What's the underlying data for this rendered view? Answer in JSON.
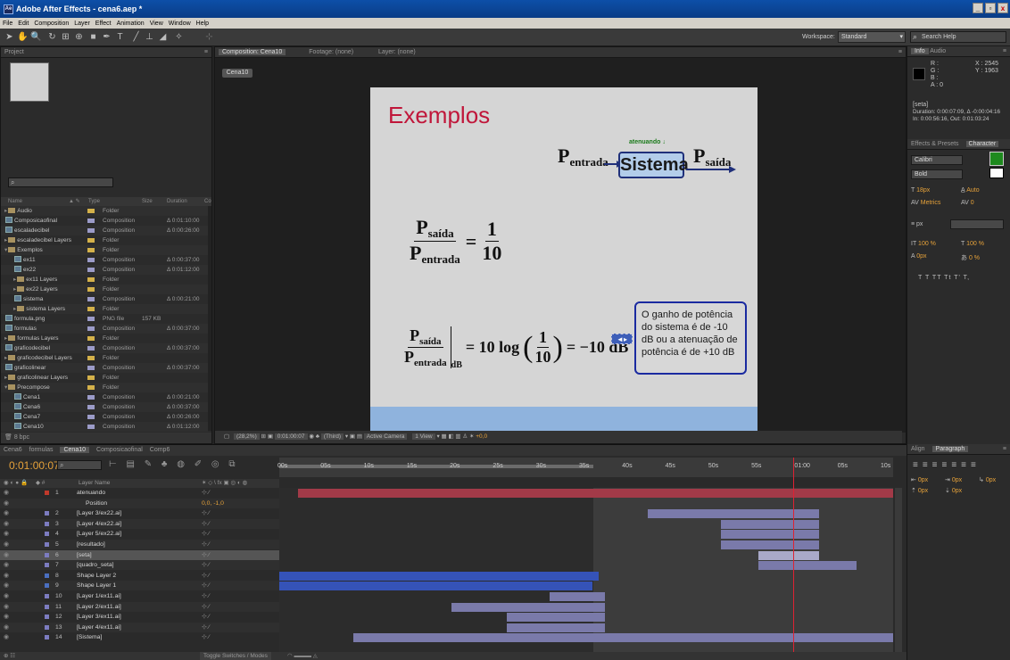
{
  "window": {
    "title": "Adobe After Effects - cena6.aep *",
    "min": "_",
    "restore": "▫",
    "close": "x"
  },
  "menu": [
    "File",
    "Edit",
    "Composition",
    "Layer",
    "Effect",
    "Animation",
    "View",
    "Window",
    "Help"
  ],
  "toolbar": {
    "workspace_label": "Workspace:",
    "workspace_value": "Standard",
    "search_placeholder": "Search Help"
  },
  "project": {
    "tab": "Project",
    "columns": {
      "name": "Name",
      "type": "Type",
      "size": "Size",
      "duration": "Duration",
      "extra": "Co"
    },
    "items": [
      {
        "name": "Audio",
        "type": "Folder",
        "size": "",
        "duration": "",
        "kind": "folder",
        "indent": 0,
        "tri": "▸",
        "color": "#d4b14a"
      },
      {
        "name": "Composicaofinal",
        "type": "Composition",
        "size": "",
        "duration": "Δ 0:01:10:00",
        "kind": "comp",
        "indent": 0,
        "tri": "",
        "color": "#9b9bc8"
      },
      {
        "name": "escaladecibel",
        "type": "Composition",
        "size": "",
        "duration": "Δ 0:00:26:00",
        "kind": "comp",
        "indent": 0,
        "tri": "",
        "color": "#9b9bc8"
      },
      {
        "name": "escaladecibel Layers",
        "type": "Folder",
        "size": "",
        "duration": "",
        "kind": "folder",
        "indent": 0,
        "tri": "▸",
        "color": "#d4b14a"
      },
      {
        "name": "Exemplos",
        "type": "Folder",
        "size": "",
        "duration": "",
        "kind": "folder",
        "indent": 0,
        "tri": "▾",
        "color": "#d4b14a"
      },
      {
        "name": "ex11",
        "type": "Composition",
        "size": "",
        "duration": "Δ 0:00:37:00",
        "kind": "comp",
        "indent": 1,
        "tri": "",
        "color": "#9b9bc8"
      },
      {
        "name": "ex22",
        "type": "Composition",
        "size": "",
        "duration": "Δ 0:01:12:00",
        "kind": "comp",
        "indent": 1,
        "tri": "",
        "color": "#9b9bc8"
      },
      {
        "name": "ex11 Layers",
        "type": "Folder",
        "size": "",
        "duration": "",
        "kind": "folder",
        "indent": 1,
        "tri": "▸",
        "color": "#d4b14a"
      },
      {
        "name": "ex22 Layers",
        "type": "Folder",
        "size": "",
        "duration": "",
        "kind": "folder",
        "indent": 1,
        "tri": "▸",
        "color": "#d4b14a"
      },
      {
        "name": "sistema",
        "type": "Composition",
        "size": "",
        "duration": "Δ 0:00:21:00",
        "kind": "comp",
        "indent": 1,
        "tri": "",
        "color": "#9b9bc8"
      },
      {
        "name": "sistema Layers",
        "type": "Folder",
        "size": "",
        "duration": "",
        "kind": "folder",
        "indent": 1,
        "tri": "▸",
        "color": "#d4b14a"
      },
      {
        "name": "formula.png",
        "type": "PNG file",
        "size": "157 KB",
        "duration": "",
        "kind": "file",
        "indent": 0,
        "tri": "",
        "color": "#9b9bc8"
      },
      {
        "name": "formulas",
        "type": "Composition",
        "size": "",
        "duration": "Δ 0:00:37:00",
        "kind": "comp",
        "indent": 0,
        "tri": "",
        "color": "#9b9bc8"
      },
      {
        "name": "formulas Layers",
        "type": "Folder",
        "size": "",
        "duration": "",
        "kind": "folder",
        "indent": 0,
        "tri": "▸",
        "color": "#d4b14a"
      },
      {
        "name": "graficodecibel",
        "type": "Composition",
        "size": "",
        "duration": "Δ 0:00:37:00",
        "kind": "comp",
        "indent": 0,
        "tri": "",
        "color": "#9b9bc8"
      },
      {
        "name": "graficodecibel Layers",
        "type": "Folder",
        "size": "",
        "duration": "",
        "kind": "folder",
        "indent": 0,
        "tri": "▸",
        "color": "#d4b14a"
      },
      {
        "name": "graficolinear",
        "type": "Composition",
        "size": "",
        "duration": "Δ 0:00:37:00",
        "kind": "comp",
        "indent": 0,
        "tri": "",
        "color": "#9b9bc8"
      },
      {
        "name": "graficolinear Layers",
        "type": "Folder",
        "size": "",
        "duration": "",
        "kind": "folder",
        "indent": 0,
        "tri": "▸",
        "color": "#d4b14a"
      },
      {
        "name": "Precompose",
        "type": "Folder",
        "size": "",
        "duration": "",
        "kind": "folder",
        "indent": 0,
        "tri": "▾",
        "color": "#d4b14a"
      },
      {
        "name": "Cena1",
        "type": "Composition",
        "size": "",
        "duration": "Δ 0:00:21:00",
        "kind": "comp",
        "indent": 1,
        "tri": "",
        "color": "#9b9bc8"
      },
      {
        "name": "Cena6",
        "type": "Composition",
        "size": "",
        "duration": "Δ 0:00:37:00",
        "kind": "comp",
        "indent": 1,
        "tri": "",
        "color": "#9b9bc8"
      },
      {
        "name": "Cena7",
        "type": "Composition",
        "size": "",
        "duration": "Δ 0:00:26:00",
        "kind": "comp",
        "indent": 1,
        "tri": "",
        "color": "#9b9bc8"
      },
      {
        "name": "Cena10",
        "type": "Composition",
        "size": "",
        "duration": "Δ 0:01:12:00",
        "kind": "comp",
        "indent": 1,
        "tri": "",
        "color": "#9b9bc8"
      }
    ],
    "footer": "8 bpc"
  },
  "composition": {
    "tab": "Composition: Cena10",
    "footage_tab": "Footage: (none)",
    "layer_tab": "Layer: (none)",
    "comp_name": "Cena10",
    "controls": {
      "zoom": "(28,2%)",
      "time": "0:01:00:07",
      "resolution": "(Third)",
      "camera": "Active Camera",
      "views": "1 View",
      "exposure": "+0,0"
    }
  },
  "slide": {
    "heading": "Exemplos",
    "p_entrada_letter": "P",
    "entrada": "entrada",
    "saida": "saída",
    "atenuando": "atenuando ↓",
    "sistema": "Sistema",
    "eq1_num": "1",
    "eq1_den": "10",
    "eq_equals": "=",
    "eq2_main": "= 10 log",
    "eq2_result": "= −10 dB",
    "eq2_sub": "dB",
    "arrow": "◄▸",
    "info": "O ganho de potência do sistema é de -10 dB ou a atenuação de potência é de +10 dB"
  },
  "info_panel": {
    "tabs": [
      "Info",
      "Audio"
    ],
    "r": "R :",
    "g": "G :",
    "b": "B :",
    "a": "A : 0",
    "x": "X : 2545",
    "y": "Y : 1963",
    "layer": "[seta]",
    "duration": "Duration: 0:00:07:09, Δ -0:00:04:16",
    "inout": "In: 0:00:56:16, Out: 0:01:03:24"
  },
  "character_panel": {
    "tabs": [
      "Effects & Presets",
      "Character"
    ],
    "font": "Calibri",
    "style": "Bold",
    "size": "18px",
    "leading": "Auto",
    "kerning": "Metrics",
    "tracking": "0",
    "stroke": "px",
    "vscale": "100 %",
    "hscale": "100 %",
    "baseline": "0px",
    "tsume": "0 %",
    "styles": "T  T  TT  Tt  T'  T,"
  },
  "timeline": {
    "tabs": [
      "Cena6",
      "formulas",
      "Cena10",
      "Composicaofinal",
      "Comp6"
    ],
    "active_tab": "Cena10",
    "timecode": "0:01:00:07",
    "layer_header": "Layer Name",
    "ruler": [
      "00s",
      "05s",
      "10s",
      "15s",
      "20s",
      "25s",
      "30s",
      "35s",
      "40s",
      "45s",
      "50s",
      "55s",
      "01:00",
      "05s",
      "10s"
    ],
    "layers": [
      {
        "num": "1",
        "name": "atenuando",
        "color": "#c0392b",
        "bar": [
          0.03,
          1.0
        ],
        "barcolor": "#a23a48",
        "text": true
      },
      {
        "num": "",
        "name": "Position",
        "color": "",
        "bar": null,
        "barcolor": "",
        "prop": true,
        "value": "0,0, -1,0"
      },
      {
        "num": "2",
        "name": "[Layer 3/ex22.ai]",
        "color": "#7c7cc0",
        "bar": [
          0.6,
          0.88
        ],
        "barcolor": "#7a7aaa"
      },
      {
        "num": "3",
        "name": "[Layer 4/ex22.ai]",
        "color": "#7c7cc0",
        "bar": [
          0.72,
          0.88
        ],
        "barcolor": "#7a7aaa"
      },
      {
        "num": "4",
        "name": "[Layer 5/ex22.ai]",
        "color": "#7c7cc0",
        "bar": [
          0.72,
          0.88
        ],
        "barcolor": "#7a7aaa"
      },
      {
        "num": "5",
        "name": "[resultado]",
        "color": "#7c7cc0",
        "bar": [
          0.72,
          0.88
        ],
        "barcolor": "#7a7aaa"
      },
      {
        "num": "6",
        "name": "[seta]",
        "color": "#7c7cc0",
        "bar": [
          0.78,
          0.88
        ],
        "barcolor": "#a9a9c9"
      },
      {
        "num": "7",
        "name": "[quadro_seta]",
        "color": "#7c7cc0",
        "bar": [
          0.78,
          0.94
        ],
        "barcolor": "#7a7aaa"
      },
      {
        "num": "8",
        "name": "Shape Layer 2",
        "color": "#4a6fc0",
        "bar": [
          0.0,
          0.52
        ],
        "barcolor": "#3553b8"
      },
      {
        "num": "9",
        "name": "Shape Layer 1",
        "color": "#4a6fc0",
        "bar": [
          0.0,
          0.51
        ],
        "barcolor": "#3553b8"
      },
      {
        "num": "10",
        "name": "[Layer 1/ex11.ai]",
        "color": "#7c7cc0",
        "bar": [
          0.44,
          0.53
        ],
        "barcolor": "#7a7aaa"
      },
      {
        "num": "11",
        "name": "[Layer 2/ex11.ai]",
        "color": "#7c7cc0",
        "bar": [
          0.28,
          0.53
        ],
        "barcolor": "#7a7aaa"
      },
      {
        "num": "12",
        "name": "[Layer 3/ex11.ai]",
        "color": "#7c7cc0",
        "bar": [
          0.37,
          0.53
        ],
        "barcolor": "#7a7aaa"
      },
      {
        "num": "13",
        "name": "[Layer 4/ex11.ai]",
        "color": "#7c7cc0",
        "bar": [
          0.37,
          0.53
        ],
        "barcolor": "#7a7aaa"
      },
      {
        "num": "14",
        "name": "[Sistema]",
        "color": "#7c7cc0",
        "bar": [
          0.12,
          1.0
        ],
        "barcolor": "#7a7aaa"
      }
    ],
    "footer": "Toggle Switches / Modes"
  },
  "align_panel": {
    "tabs": [
      "Align",
      "Paragraph"
    ],
    "indent1": "0px",
    "indent2": "0px",
    "indent3": "0px",
    "space1": "0px",
    "space2": "0px"
  }
}
